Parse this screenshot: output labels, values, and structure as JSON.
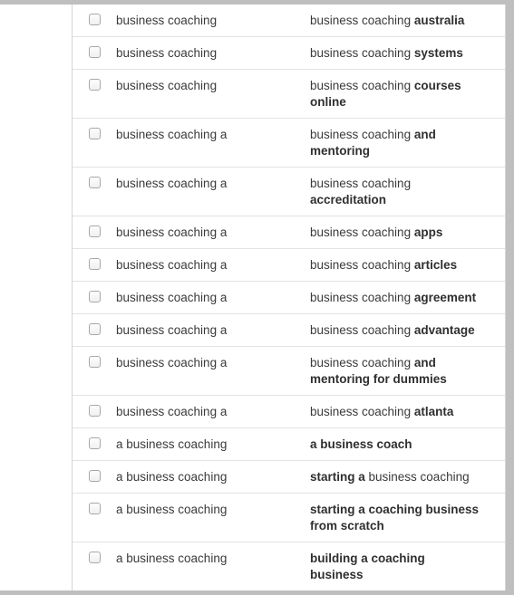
{
  "table": {
    "checkbox_icon": "checkbox-unchecked-icon",
    "columns": [
      "select",
      "seed_keyword",
      "suggested_keyword"
    ],
    "rows": [
      {
        "checked": false,
        "seed": "business coaching",
        "keyword_plain": "business coaching ",
        "keyword_bold": "australia",
        "keyword_trailing": ""
      },
      {
        "checked": false,
        "seed": "business coaching",
        "keyword_plain": "business coaching ",
        "keyword_bold": "systems",
        "keyword_trailing": ""
      },
      {
        "checked": false,
        "seed": "business coaching",
        "keyword_plain": "business coaching ",
        "keyword_bold": "courses online",
        "keyword_trailing": ""
      },
      {
        "checked": false,
        "seed": "business coaching a",
        "keyword_plain": "business coaching ",
        "keyword_bold": "and mentoring",
        "keyword_trailing": ""
      },
      {
        "checked": false,
        "seed": "business coaching a",
        "keyword_plain": "business coaching ",
        "keyword_bold": "accreditation",
        "keyword_trailing": ""
      },
      {
        "checked": false,
        "seed": "business coaching a",
        "keyword_plain": "business coaching ",
        "keyword_bold": "apps",
        "keyword_trailing": ""
      },
      {
        "checked": false,
        "seed": "business coaching a",
        "keyword_plain": "business coaching ",
        "keyword_bold": "articles",
        "keyword_trailing": ""
      },
      {
        "checked": false,
        "seed": "business coaching a",
        "keyword_plain": "business coaching ",
        "keyword_bold": "agreement",
        "keyword_trailing": ""
      },
      {
        "checked": false,
        "seed": "business coaching a",
        "keyword_plain": "business coaching ",
        "keyword_bold": "advantage",
        "keyword_trailing": ""
      },
      {
        "checked": false,
        "seed": "business coaching a",
        "keyword_plain": "business coaching ",
        "keyword_bold": "and mentoring for dummies",
        "keyword_trailing": ""
      },
      {
        "checked": false,
        "seed": "business coaching a",
        "keyword_plain": "business coaching ",
        "keyword_bold": "atlanta",
        "keyword_trailing": ""
      },
      {
        "checked": false,
        "seed": "a business coaching",
        "keyword_plain": "",
        "keyword_bold": "a business coach",
        "keyword_trailing": ""
      },
      {
        "checked": false,
        "seed": "a business coaching",
        "keyword_plain": "",
        "keyword_bold": "starting a",
        "keyword_trailing": " business coaching"
      },
      {
        "checked": false,
        "seed": "a business coaching",
        "keyword_plain": "",
        "keyword_bold": "starting a coaching business from scratch",
        "keyword_trailing": ""
      },
      {
        "checked": false,
        "seed": "a business coaching",
        "keyword_plain": "",
        "keyword_bold": "building a coaching business",
        "keyword_trailing": ""
      }
    ]
  },
  "colors": {
    "text": "#3a3a3a",
    "bold_text": "#2f2f2f",
    "row_border": "#e2e2e2",
    "table_border": "#d5d5d5",
    "chrome_grey": "#bfbfbf",
    "background": "#ffffff"
  }
}
